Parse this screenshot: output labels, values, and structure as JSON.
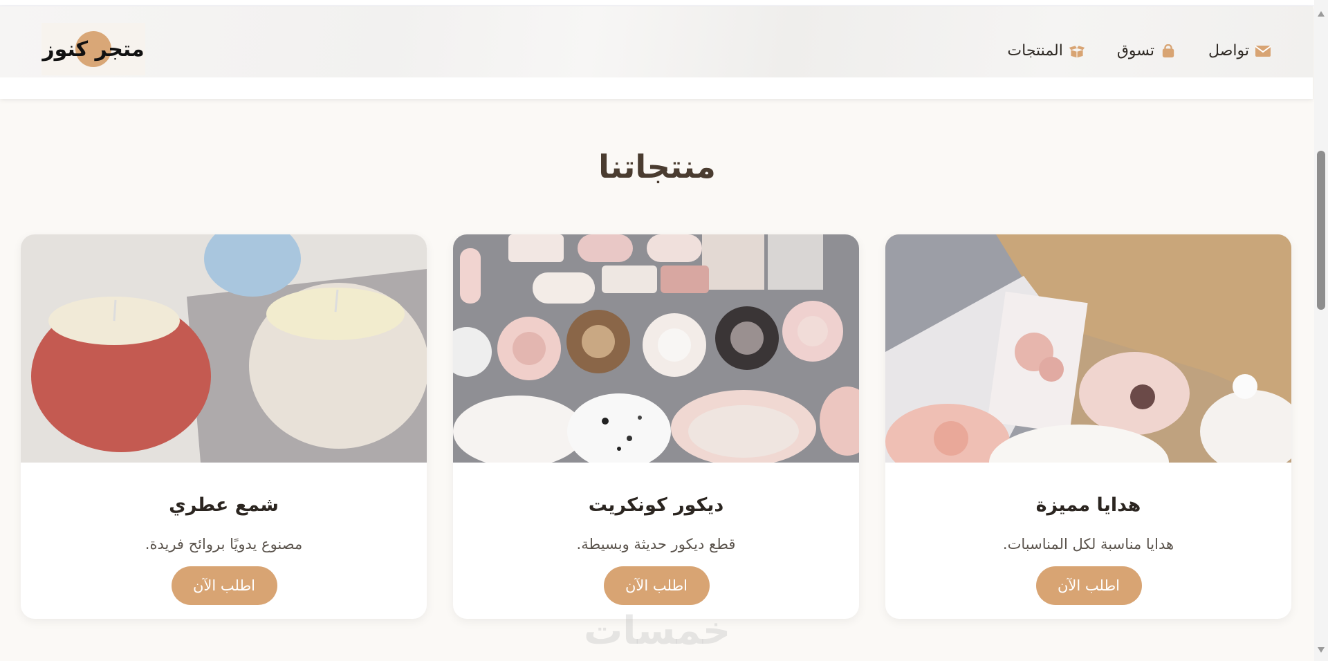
{
  "header": {
    "logo_text": "متجر كنوز",
    "nav": [
      {
        "label": "تواصل",
        "icon": "envelope-icon"
      },
      {
        "label": "تسوق",
        "icon": "shopping-bag-icon"
      },
      {
        "label": "المنتجات",
        "icon": "box-open-icon"
      }
    ]
  },
  "section": {
    "title": "منتجاتنا"
  },
  "products": [
    {
      "title": "هدايا مميزة",
      "description": ".هدايا مناسبة لكل المناسبات",
      "button": "اطلب الآن",
      "image": "gift-box-photo"
    },
    {
      "title": "ديكور كونكريت",
      "description": ".قطع ديكور حديثة وبسيطة",
      "button": "اطلب الآن",
      "image": "concrete-decor-photo"
    },
    {
      "title": "شمع عطري",
      "description": ".مصنوع يدويًا بروائح فريدة",
      "button": "اطلب الآن",
      "image": "scented-candles-photo"
    }
  ],
  "watermark": "خمسات",
  "colors": {
    "accent": "#d8a473",
    "title": "#4a3c30",
    "background": "#fbf9f6"
  }
}
